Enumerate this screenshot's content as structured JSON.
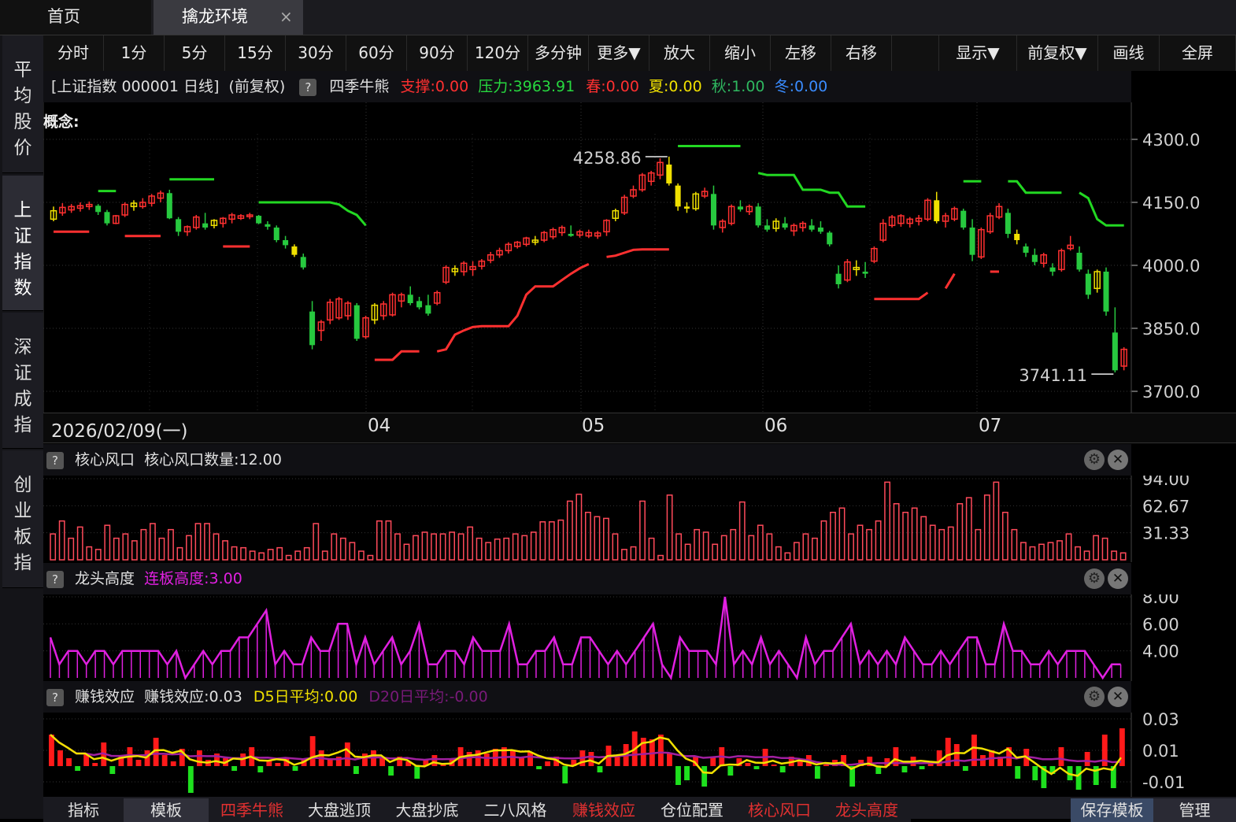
{
  "tabs": {
    "home": "首页",
    "active": "擒龙环境",
    "close": "×"
  },
  "sidebar": [
    "平均股价",
    "上证指数",
    "深证成指",
    "创业板指"
  ],
  "toolbar": [
    "分时",
    "1分",
    "5分",
    "15分",
    "30分",
    "60分",
    "90分",
    "120分",
    "多分钟",
    "更多▼",
    "放大",
    "缩小",
    "左移",
    "右移",
    "",
    "显示▼",
    "前复权▼",
    "画线",
    "全屏"
  ],
  "infobar": {
    "title": "[上证指数 000001 日线]",
    "adj": "(前复权)",
    "q": "?",
    "indicator": "四季牛熊",
    "support": "支撑:0.00",
    "pressure": "压力:3963.91",
    "spring": "春:0.00",
    "summer": "夏:0.00",
    "autumn": "秋:1.00",
    "winter": "冬:0.00"
  },
  "concept_label": "概念:",
  "date_axis": {
    "start": "2026/02/09(一)",
    "months": [
      "04",
      "05",
      "06",
      "07"
    ]
  },
  "panels": {
    "p1": {
      "name": "核心风口",
      "value": "核心风口数量:12.00"
    },
    "p2": {
      "name": "龙头高度",
      "value": "连板高度:3.00"
    },
    "p3": {
      "name": "赚钱效应",
      "value": "赚钱效应:0.03",
      "d5": "D5日平均:0.00",
      "d20": "D20日平均:-0.00"
    }
  },
  "bottom_bar": [
    "指标",
    "模板",
    "四季牛熊",
    "大盘逃顶",
    "大盘抄底",
    "二八风格",
    "赚钱效应",
    "仓位配置",
    "核心风口",
    "龙头高度",
    "保存模板",
    "管理"
  ],
  "colors": {
    "up": "#ff3030",
    "down": "#27c93f",
    "yellow": "#f0e000",
    "magenta": "#e020e0",
    "bg": "#000000",
    "grid": "#3a3a3a"
  },
  "chart_data": [
    {
      "type": "candlestick",
      "title": "上证指数 000001 日线",
      "ylim": [
        3700,
        4300
      ],
      "yticks": [
        "4300.0",
        "4150.0",
        "4000.0",
        "3850.0",
        "3700.0"
      ],
      "annotations": {
        "high": "4258.86",
        "low": "3741.11"
      },
      "support_line": "支撑",
      "ohlc": [
        [
          4110,
          4140,
          4105,
          4130
        ],
        [
          4125,
          4148,
          4118,
          4138
        ],
        [
          4132,
          4146,
          4125,
          4140
        ],
        [
          4136,
          4150,
          4128,
          4142
        ],
        [
          4140,
          4152,
          4132,
          4145
        ],
        [
          4142,
          4146,
          4120,
          4127
        ],
        [
          4127,
          4132,
          4095,
          4100
        ],
        [
          4100,
          4120,
          4098,
          4118
        ],
        [
          4120,
          4150,
          4115,
          4145
        ],
        [
          4140,
          4155,
          4130,
          4148
        ],
        [
          4140,
          4160,
          4135,
          4150
        ],
        [
          4148,
          4170,
          4140,
          4165
        ],
        [
          4160,
          4178,
          4150,
          4172
        ],
        [
          4172,
          4180,
          4110,
          4112
        ],
        [
          4110,
          4115,
          4070,
          4080
        ],
        [
          4080,
          4095,
          4070,
          4092
        ],
        [
          4090,
          4120,
          4085,
          4115
        ],
        [
          4100,
          4125,
          4085,
          4090
        ],
        [
          4095,
          4110,
          4088,
          4107
        ],
        [
          4100,
          4115,
          4090,
          4112
        ],
        [
          4110,
          4125,
          4100,
          4120
        ],
        [
          4112,
          4122,
          4108,
          4118
        ],
        [
          4116,
          4125,
          4110,
          4120
        ],
        [
          4118,
          4120,
          4098,
          4100
        ],
        [
          4098,
          4105,
          4085,
          4092
        ],
        [
          4090,
          4095,
          4055,
          4060
        ],
        [
          4060,
          4070,
          4040,
          4048
        ],
        [
          4045,
          4050,
          4020,
          4025
        ],
        [
          4020,
          4028,
          3990,
          3995
        ],
        [
          3890,
          3915,
          3800,
          3810
        ],
        [
          3845,
          3870,
          3820,
          3865
        ],
        [
          3870,
          3920,
          3860,
          3912
        ],
        [
          3875,
          3925,
          3870,
          3920
        ],
        [
          3880,
          3915,
          3870,
          3910
        ],
        [
          3905,
          3910,
          3820,
          3825
        ],
        [
          3830,
          3880,
          3825,
          3875
        ],
        [
          3870,
          3910,
          3860,
          3905
        ],
        [
          3880,
          3915,
          3870,
          3908
        ],
        [
          3882,
          3935,
          3878,
          3930
        ],
        [
          3915,
          3935,
          3900,
          3930
        ],
        [
          3930,
          3950,
          3905,
          3910
        ],
        [
          3915,
          3925,
          3895,
          3900
        ],
        [
          3905,
          3930,
          3880,
          3885
        ],
        [
          3910,
          3940,
          3905,
          3935
        ],
        [
          3960,
          4000,
          3955,
          3995
        ],
        [
          3985,
          4000,
          3975,
          3992
        ],
        [
          3985,
          4010,
          3975,
          4005
        ],
        [
          3990,
          4010,
          3975,
          3997
        ],
        [
          3998,
          4015,
          3990,
          4010
        ],
        [
          4012,
          4032,
          4005,
          4025
        ],
        [
          4025,
          4042,
          4018,
          4035
        ],
        [
          4035,
          4055,
          4028,
          4050
        ],
        [
          4045,
          4058,
          4040,
          4055
        ],
        [
          4050,
          4068,
          4045,
          4065
        ],
        [
          4055,
          4070,
          4048,
          4060
        ],
        [
          4060,
          4082,
          4055,
          4078
        ],
        [
          4068,
          4090,
          4062,
          4085
        ],
        [
          4078,
          4095,
          4070,
          4090
        ],
        [
          4075,
          4095,
          4068,
          4070
        ],
        [
          4072,
          4085,
          4066,
          4080
        ],
        [
          4070,
          4085,
          4065,
          4078
        ],
        [
          4070,
          4082,
          4063,
          4077
        ],
        [
          4080,
          4110,
          4070,
          4107
        ],
        [
          4112,
          4135,
          4105,
          4130
        ],
        [
          4125,
          4168,
          4120,
          4162
        ],
        [
          4165,
          4190,
          4160,
          4180
        ],
        [
          4180,
          4220,
          4175,
          4215
        ],
        [
          4200,
          4225,
          4190,
          4220
        ],
        [
          4215,
          4255,
          4205,
          4245
        ],
        [
          4240,
          4259,
          4190,
          4195
        ],
        [
          4190,
          4195,
          4130,
          4140
        ],
        [
          4140,
          4150,
          4125,
          4135
        ],
        [
          4135,
          4175,
          4130,
          4170
        ],
        [
          4165,
          4185,
          4160,
          4176
        ],
        [
          4170,
          4190,
          4085,
          4095
        ],
        [
          4090,
          4110,
          4078,
          4105
        ],
        [
          4100,
          4145,
          4095,
          4140
        ],
        [
          4140,
          4155,
          4128,
          4133
        ],
        [
          4128,
          4145,
          4120,
          4140
        ],
        [
          4140,
          4148,
          4090,
          4095
        ],
        [
          4095,
          4110,
          4080,
          4085
        ],
        [
          4088,
          4112,
          4080,
          4105
        ],
        [
          4100,
          4115,
          4085,
          4090
        ],
        [
          4082,
          4100,
          4070,
          4095
        ],
        [
          4090,
          4105,
          4080,
          4100
        ],
        [
          4095,
          4110,
          4080,
          4085
        ],
        [
          4090,
          4105,
          4075,
          4080
        ],
        [
          4078,
          4082,
          4045,
          4050
        ],
        [
          3980,
          4000,
          3945,
          3955
        ],
        [
          3965,
          4015,
          3960,
          4008
        ],
        [
          3990,
          4012,
          3975,
          3995
        ],
        [
          3985,
          4008,
          3970,
          3980
        ],
        [
          4010,
          4045,
          4005,
          4040
        ],
        [
          4060,
          4110,
          4055,
          4100
        ],
        [
          4095,
          4120,
          4090,
          4115
        ],
        [
          4100,
          4122,
          4092,
          4118
        ],
        [
          4100,
          4115,
          4090,
          4110
        ],
        [
          4105,
          4120,
          4095,
          4112
        ],
        [
          4110,
          4160,
          4105,
          4155
        ],
        [
          4155,
          4175,
          4100,
          4105
        ],
        [
          4105,
          4125,
          4090,
          4118
        ],
        [
          4110,
          4140,
          4105,
          4135
        ],
        [
          4130,
          4135,
          4085,
          4090
        ],
        [
          4090,
          4110,
          4010,
          4025
        ],
        [
          4020,
          4090,
          4015,
          4085
        ],
        [
          4080,
          4125,
          4075,
          4118
        ],
        [
          4115,
          4148,
          4110,
          4140
        ],
        [
          4125,
          4135,
          4065,
          4075
        ],
        [
          4075,
          4085,
          4050,
          4060
        ],
        [
          4045,
          4052,
          4020,
          4030
        ],
        [
          4025,
          4040,
          4000,
          4008
        ],
        [
          4005,
          4030,
          3995,
          4025
        ],
        [
          3995,
          4005,
          3975,
          3985
        ],
        [
          3990,
          4040,
          3985,
          4035
        ],
        [
          4040,
          4070,
          4035,
          4048
        ],
        [
          4030,
          4045,
          3985,
          3990
        ],
        [
          3980,
          3990,
          3920,
          3930
        ],
        [
          3945,
          3990,
          3935,
          3985
        ],
        [
          3985,
          3995,
          3880,
          3890
        ],
        [
          3840,
          3900,
          3745,
          3750
        ],
        [
          3760,
          3805,
          3750,
          3800
        ]
      ]
    },
    {
      "type": "bar",
      "title": "核心风口数量",
      "ylim": [
        0,
        94
      ],
      "yticks": [
        "94.00",
        "62.67",
        "31.33"
      ],
      "values": [
        30,
        45,
        25,
        38,
        15,
        12,
        40,
        25,
        30,
        22,
        35,
        42,
        25,
        35,
        14,
        28,
        42,
        42,
        30,
        22,
        15,
        14,
        10,
        8,
        12,
        14,
        5,
        10,
        14,
        42,
        10,
        30,
        25,
        20,
        10,
        5,
        45,
        45,
        30,
        18,
        28,
        32,
        30,
        30,
        32,
        30,
        38,
        25,
        20,
        24,
        25,
        30,
        28,
        32,
        44,
        44,
        46,
        68,
        76,
        55,
        50,
        48,
        30,
        12,
        15,
        68,
        25,
        5,
        75,
        30,
        18,
        35,
        32,
        18,
        28,
        35,
        67,
        28,
        40,
        30,
        15,
        8,
        20,
        30,
        25,
        45,
        55,
        60,
        30,
        40,
        35,
        45,
        90,
        65,
        55,
        60,
        50,
        40,
        35,
        38,
        65,
        72,
        35,
        75,
        90,
        55,
        35,
        20,
        15,
        18,
        20,
        22,
        30,
        15,
        10,
        28,
        25,
        10,
        8
      ]
    },
    {
      "type": "line",
      "title": "连板高度",
      "ylim": [
        2,
        8
      ],
      "yticks": [
        "8.00",
        "6.00",
        "4.00"
      ],
      "values": [
        5,
        3,
        4,
        4,
        3,
        4,
        4,
        3,
        4,
        4,
        4,
        4,
        4,
        3,
        4,
        2,
        3,
        4,
        3,
        4,
        4,
        5,
        5,
        6,
        7,
        3,
        4,
        3,
        3,
        5,
        4,
        4,
        6,
        6,
        3,
        5,
        3,
        4,
        5,
        3,
        4,
        6,
        3,
        3,
        4,
        4,
        3,
        5,
        4,
        4,
        4,
        6,
        3,
        3,
        4,
        4,
        5,
        3,
        3,
        5,
        5,
        4,
        3,
        4,
        3,
        4,
        5,
        6,
        3,
        2,
        5,
        4,
        4,
        4,
        3,
        8,
        3,
        4,
        3,
        5,
        3,
        4,
        3,
        2,
        5,
        3,
        4,
        4,
        5,
        6,
        3,
        4,
        3,
        4,
        3,
        5,
        4,
        3,
        3,
        4,
        3,
        4,
        5,
        5,
        3,
        3,
        6,
        4,
        4,
        3,
        3,
        4,
        3,
        4,
        4,
        4,
        3,
        2,
        3,
        3
      ]
    },
    {
      "type": "bar+line",
      "title": "赚钱效应",
      "ylim": [
        -0.017,
        0.032
      ],
      "yticks": [
        "0.03",
        "0.01",
        "-0.01"
      ],
      "series": [
        {
          "name": "赚钱效应"
        },
        {
          "name": "D5日平均"
        },
        {
          "name": "D20日平均"
        }
      ],
      "values": [
        0.02,
        0.01,
        0.005,
        -0.003,
        0.008,
        0.002,
        0.015,
        -0.005,
        0.006,
        0.012,
        0.004,
        0.01,
        0.018,
        0.007,
        0.003,
        0.011,
        -0.017,
        0.01,
        0.004,
        0.008,
        0.005,
        -0.003,
        0.008,
        0.012,
        -0.004,
        0.004,
        0.002,
        0.005,
        -0.003,
        0.004,
        0.019,
        0.01,
        0.004,
        0.006,
        0.015,
        -0.005,
        0.008,
        0.01,
        0.006,
        -0.006,
        0.006,
        0.003,
        -0.008,
        0.004,
        0.007,
        0.001,
        0.004,
        0.012,
        0.009,
        0.01,
        0.008,
        0.011,
        0.012,
        0.01,
        0.005,
        0.009,
        -0.002,
        0.003,
        0.006,
        -0.011,
        0.004,
        0.01,
        0.009,
        -0.004,
        0.013,
        0.006,
        0.014,
        0.022,
        0.018,
        0.017,
        0.02,
        0.008,
        -0.012,
        -0.009,
        0.006,
        -0.013,
        0.006,
        0.012,
        -0.006,
        0.005,
        0.002,
        -0.002,
        0.011,
        0.001,
        -0.004,
        0.006,
        0.004,
        0.007,
        -0.008,
        0.001,
        0.004,
        0.007,
        -0.013,
        0.004,
        0.006,
        -0.005,
        0.005,
        0.012,
        -0.004,
        0.006,
        -0.002,
        0.002,
        0.01,
        0.018,
        0.014,
        -0.003,
        0.02,
        0.007,
        0.01,
        0.006,
        0.012,
        -0.008,
        0.011,
        -0.009,
        -0.014,
        -0.005,
        0.012,
        -0.009,
        -0.015,
        0.009,
        -0.012,
        0.02,
        -0.014,
        0.024
      ]
    }
  ]
}
